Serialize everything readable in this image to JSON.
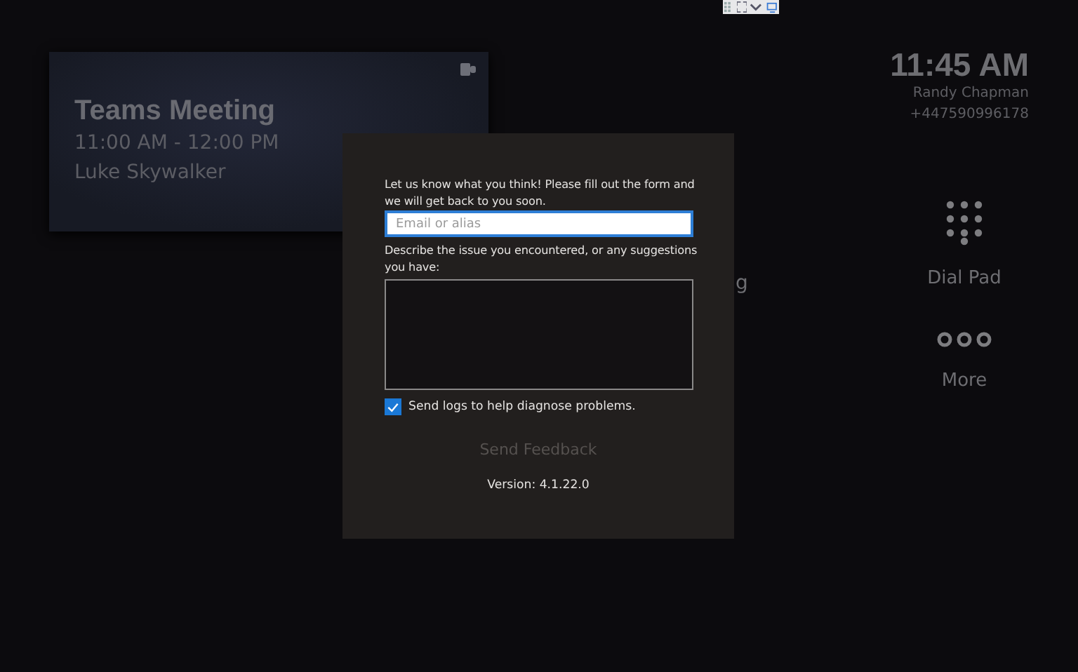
{
  "meeting": {
    "title": "Teams Meeting",
    "time": "11:00 AM - 12:00 PM",
    "organizer": "Luke Skywalker"
  },
  "clock": {
    "time": "11:45 AM",
    "user": "Randy Chapman",
    "phone": "+447590996178"
  },
  "covered_tile": {
    "label": "g"
  },
  "tiles": [
    {
      "kind": "dialpad",
      "label": "Dial Pad"
    },
    {
      "kind": "more",
      "label": "More"
    }
  ],
  "feedback": {
    "intro": "Let us know what you think! Please fill out the form and we will get back to you soon.",
    "email": {
      "placeholder": "Email or alias"
    },
    "describe_label": "Describe the issue you encountered, or any suggestions you have:",
    "send_logs": {
      "label": "Send logs to help diagnose problems.",
      "checked": true
    },
    "send_button": {
      "label": "Send Feedback",
      "disabled": true
    },
    "version": "Version: 4.1.22.0"
  }
}
